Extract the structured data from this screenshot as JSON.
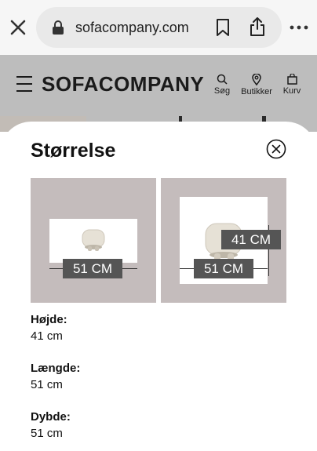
{
  "browser": {
    "url": "sofacompany.com",
    "icons": [
      "close-icon",
      "lock-icon",
      "bookmark-icon",
      "share-icon",
      "more-icon"
    ]
  },
  "header": {
    "logo": "SOFACOMPANY",
    "nav": [
      {
        "label": "Søg",
        "icon": "search-icon"
      },
      {
        "label": "Butikker",
        "icon": "location-pin-icon"
      },
      {
        "label": "Kurv",
        "icon": "bag-icon"
      }
    ]
  },
  "sheet": {
    "title": "Størrelse",
    "images": [
      {
        "labels": [
          "51 CM"
        ]
      },
      {
        "labels": [
          "41 CM",
          "51 CM"
        ]
      }
    ],
    "specs": [
      {
        "label": "Højde:",
        "value": "41 cm"
      },
      {
        "label": "Længde:",
        "value": "51 cm"
      },
      {
        "label": "Dybde:",
        "value": "51 cm"
      }
    ]
  },
  "colors": {
    "overlay": "#bdbdbd",
    "card": "#c4bcbc",
    "dim_label": "#555555"
  }
}
